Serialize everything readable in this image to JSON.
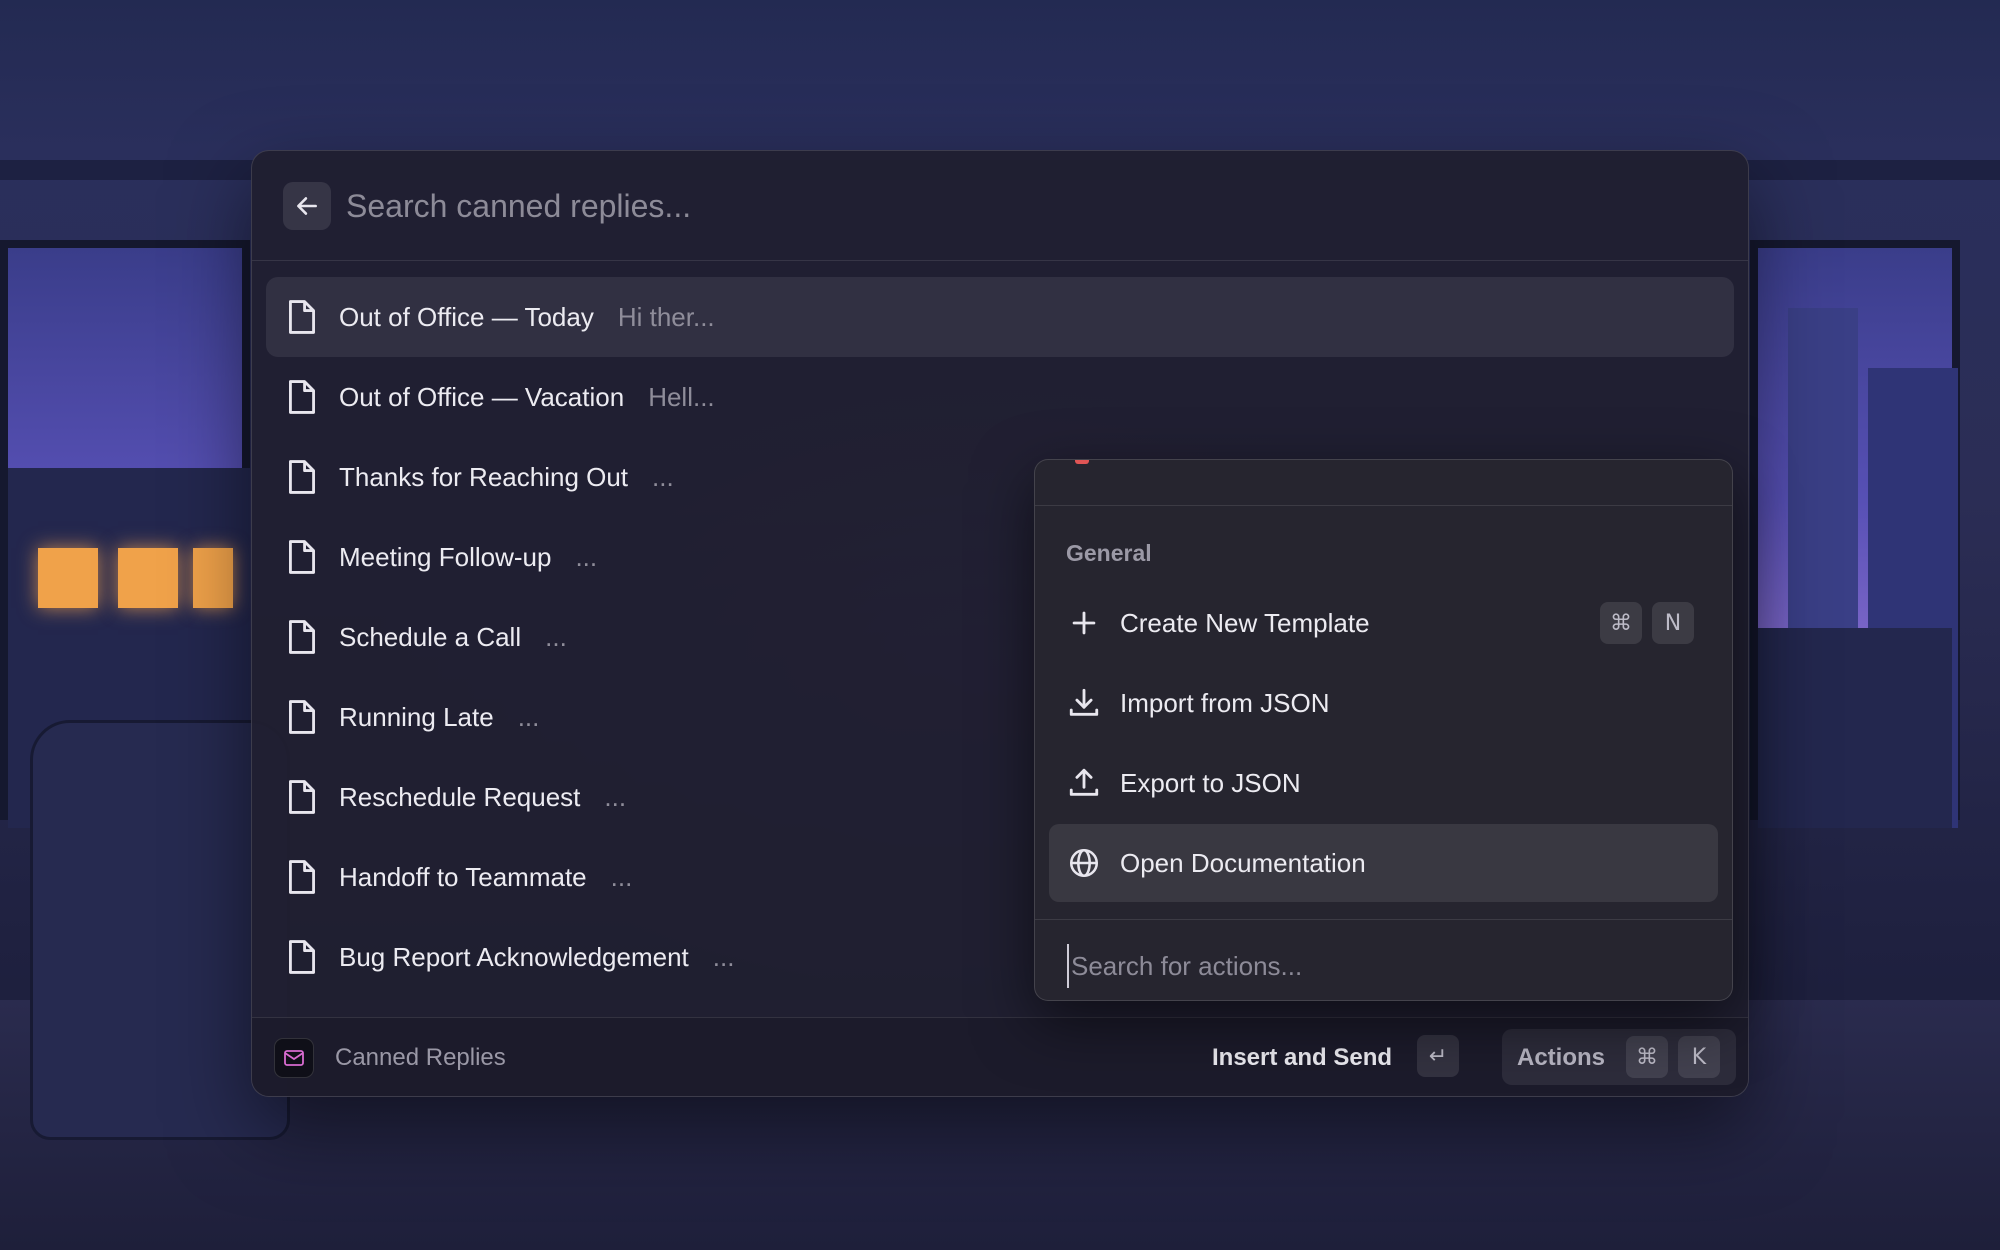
{
  "search": {
    "placeholder": "Search canned replies..."
  },
  "replies": [
    {
      "title": "Out of Office — Today",
      "preview": "Hi ther..."
    },
    {
      "title": "Out of Office — Vacation",
      "preview": "Hell..."
    },
    {
      "title": "Thanks for Reaching Out",
      "preview": "..."
    },
    {
      "title": "Meeting Follow-up",
      "preview": "..."
    },
    {
      "title": "Schedule a Call",
      "preview": "..."
    },
    {
      "title": "Running Late",
      "preview": "..."
    },
    {
      "title": "Reschedule Request",
      "preview": "..."
    },
    {
      "title": "Handoff to Teammate",
      "preview": "..."
    },
    {
      "title": "Bug Report Acknowledgement",
      "preview": "..."
    }
  ],
  "actions_panel": {
    "section": "General",
    "items": [
      {
        "label": "Create New Template",
        "icon": "plus-icon",
        "shortcut": [
          "⌘",
          "N"
        ]
      },
      {
        "label": "Import from JSON",
        "icon": "download-icon"
      },
      {
        "label": "Export to JSON",
        "icon": "upload-icon"
      },
      {
        "label": "Open Documentation",
        "icon": "globe-icon"
      }
    ],
    "search_placeholder": "Search for actions..."
  },
  "footer": {
    "app_name": "Canned Replies",
    "primary_action": "Insert and Send",
    "enter_key": "↵",
    "actions_label": "Actions",
    "actions_shortcut": [
      "⌘",
      "K"
    ]
  },
  "colors": {
    "panel_bg": "#201f30",
    "text": "#ecebf1",
    "muted": "#8f8d9a",
    "accent_red": "#e05555"
  }
}
